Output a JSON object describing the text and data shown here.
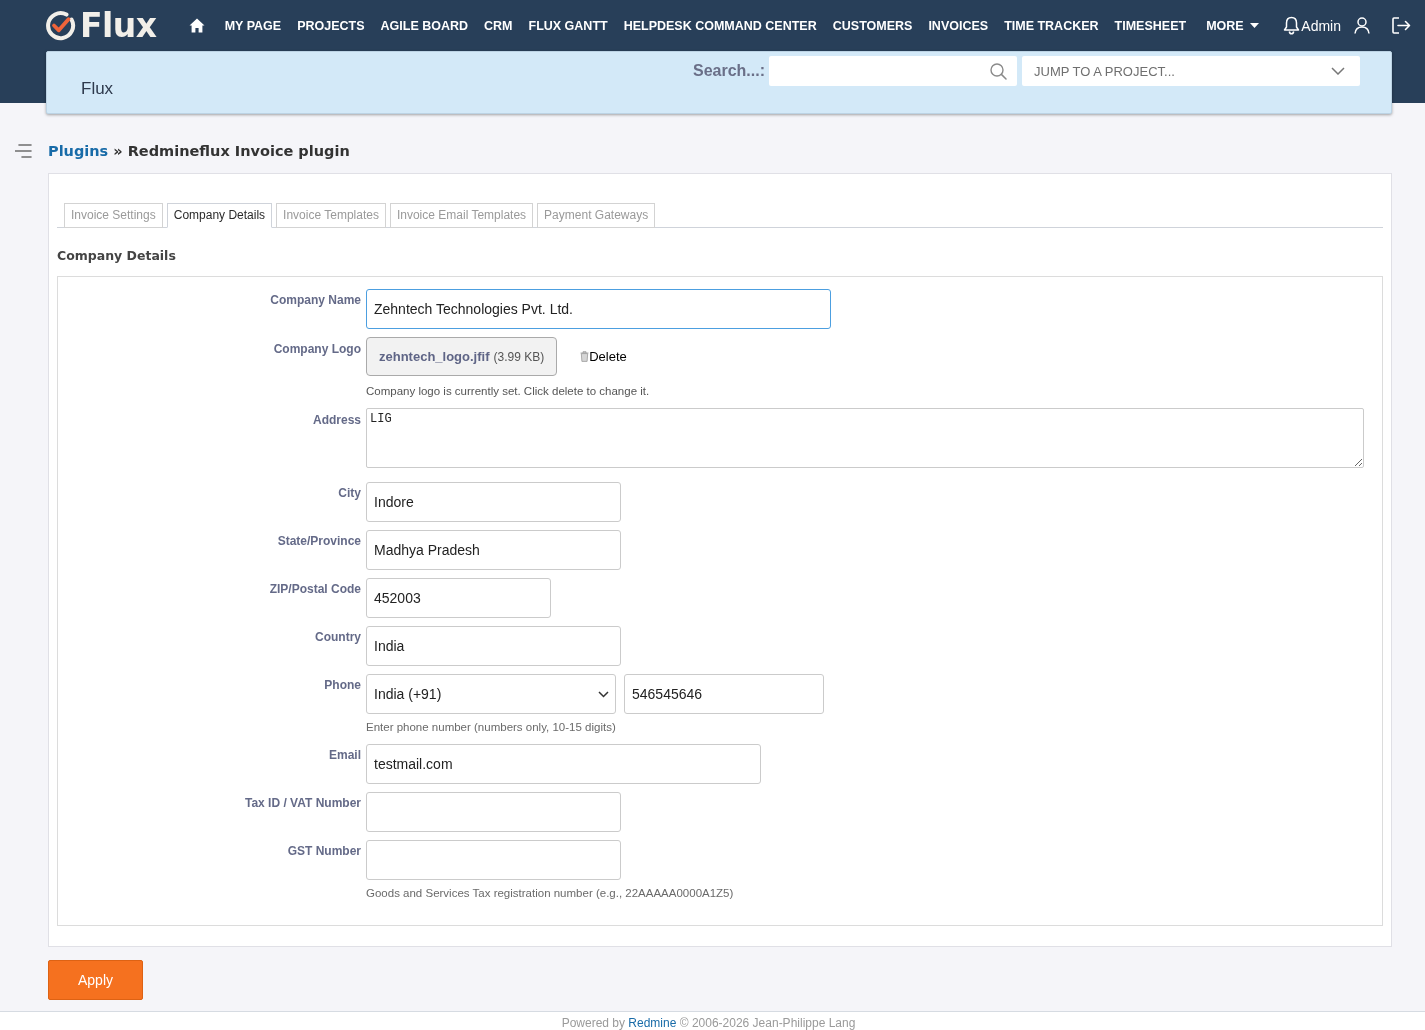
{
  "header": {
    "logo": {
      "text": "Flux"
    },
    "nav": [
      {
        "label": "MY PAGE"
      },
      {
        "label": "PROJECTS"
      },
      {
        "label": "AGILE BOARD"
      },
      {
        "label": "CRM"
      },
      {
        "label": "FLUX GANTT"
      },
      {
        "label": "HELPDESK COMMAND CENTER"
      },
      {
        "label": "CUSTOMERS"
      },
      {
        "label": "INVOICES"
      },
      {
        "label": "TIME TRACKER"
      },
      {
        "label": "TIMESHEET"
      }
    ],
    "more": {
      "label": "MORE"
    },
    "user": {
      "name": "Admin"
    }
  },
  "project_bar": {
    "title": "Flux",
    "search": {
      "label": "Search...:"
    },
    "jump": {
      "placeholder": "JUMP TO A PROJECT..."
    }
  },
  "breadcrumb": {
    "link": "Plugins",
    "separator": "»",
    "title": "Redmineflux Invoice plugin"
  },
  "tabs": [
    {
      "label": "Invoice Settings",
      "selected": false
    },
    {
      "label": "Company Details",
      "selected": true
    },
    {
      "label": "Invoice Templates",
      "selected": false
    },
    {
      "label": "Invoice Email Templates",
      "selected": false
    },
    {
      "label": "Payment Gateways",
      "selected": false
    }
  ],
  "section": {
    "title": "Company Details",
    "fields": [
      {
        "kind": "text",
        "label": "Company Name",
        "value": "Zehntech Technologies Pvt. Ltd.",
        "focused": true
      },
      {
        "kind": "file",
        "label": "Company Logo",
        "file_name": "zehntech_logo.jfif",
        "file_size": "(3.99 KB)",
        "action": "Delete",
        "hint": "Company logo is currently set. Click delete to change it.",
        "focused": false
      },
      {
        "kind": "textarea",
        "label": "Address",
        "value": "LIG",
        "focused": false
      },
      {
        "kind": "text",
        "label": "City",
        "value": "Indore",
        "focused": false
      },
      {
        "kind": "text",
        "label": "State/Province",
        "value": "Madhya Pradesh",
        "focused": false
      },
      {
        "kind": "text",
        "label": "ZIP/Postal Code",
        "value": "452003",
        "focused": false
      },
      {
        "kind": "text",
        "label": "Country",
        "value": "India",
        "focused": false
      },
      {
        "kind": "phone",
        "label": "Phone",
        "country": "India (+91)",
        "value": "546545646",
        "hint": "Enter phone number (numbers only, 10-15 digits)",
        "focused": false
      },
      {
        "kind": "text",
        "label": "Email",
        "value": "testmail.com",
        "focused": false
      },
      {
        "kind": "text",
        "label": "Tax ID / VAT Number",
        "focused": false
      },
      {
        "kind": "text",
        "label": "GST Number",
        "hint": "Goods and Services Tax registration number (e.g., 22AAAAA0000A1Z5)",
        "focused": false
      }
    ]
  },
  "apply_button": {
    "label": "Apply"
  },
  "footer": {
    "before": "Powered by",
    "link": "Redmine",
    "after": "© 2006-2026 Jean-Philippe Lang"
  }
}
